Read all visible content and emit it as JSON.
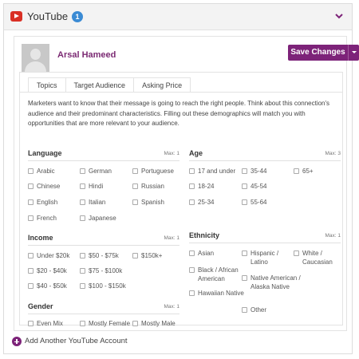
{
  "header": {
    "title": "YouTube",
    "badge_count": "1",
    "icon": "youtube-icon",
    "collapse_icon": "chevron-down-icon",
    "accent_color": "#7d2379",
    "youtube_color": "#d93025",
    "badge_color": "#3b8bd4"
  },
  "account": {
    "user_name": "Arsal Hameed",
    "avatar_icon": "user-avatar-placeholder",
    "save_label": "Save Changes"
  },
  "tabs": [
    {
      "label": "Topics"
    },
    {
      "label": "Target Audience",
      "active": true
    },
    {
      "label": "Asking Price"
    }
  ],
  "intro": "Marketers want to know that their message is going to reach the right people. Think about this connection's audience and their predominant characteristics. Filling out these demographics will match you with opportunities that are more relevant to your audience.",
  "sections": {
    "language": {
      "title": "Language",
      "max": "Max: 1",
      "options": [
        "Arabic",
        "German",
        "Portuguese",
        "Chinese",
        "Hindi",
        "Russian",
        "English",
        "Italian",
        "Spanish",
        "French",
        "Japanese"
      ]
    },
    "age": {
      "title": "Age",
      "max": "Max: 3",
      "options": [
        "17 and under",
        "35-44",
        "65+",
        "18-24",
        "45-54",
        "25-34",
        "55-64"
      ]
    },
    "income": {
      "title": "Income",
      "max": "Max: 1",
      "options": [
        "Under $20k",
        "$50 - $75k",
        "$150k+",
        "$20 - $40k",
        "$75 - $100k",
        "$40 - $50k",
        "$100 - $150k"
      ]
    },
    "ethnicity": {
      "title": "Ethnicity",
      "max": "Max: 1",
      "options": [
        "Asian",
        "Hispanic / Latino",
        "White / Caucasian",
        "Black / African American",
        "Native American / Alaska Native",
        "Hawaiian Native",
        "Other"
      ]
    },
    "gender": {
      "title": "Gender",
      "max": "Max: 1",
      "options": [
        "Even Mix",
        "Mostly Female",
        "Mostly Male"
      ]
    }
  },
  "footer": {
    "add_account_label": "Add Another YouTube Account",
    "add_icon": "plus-circle-icon"
  }
}
